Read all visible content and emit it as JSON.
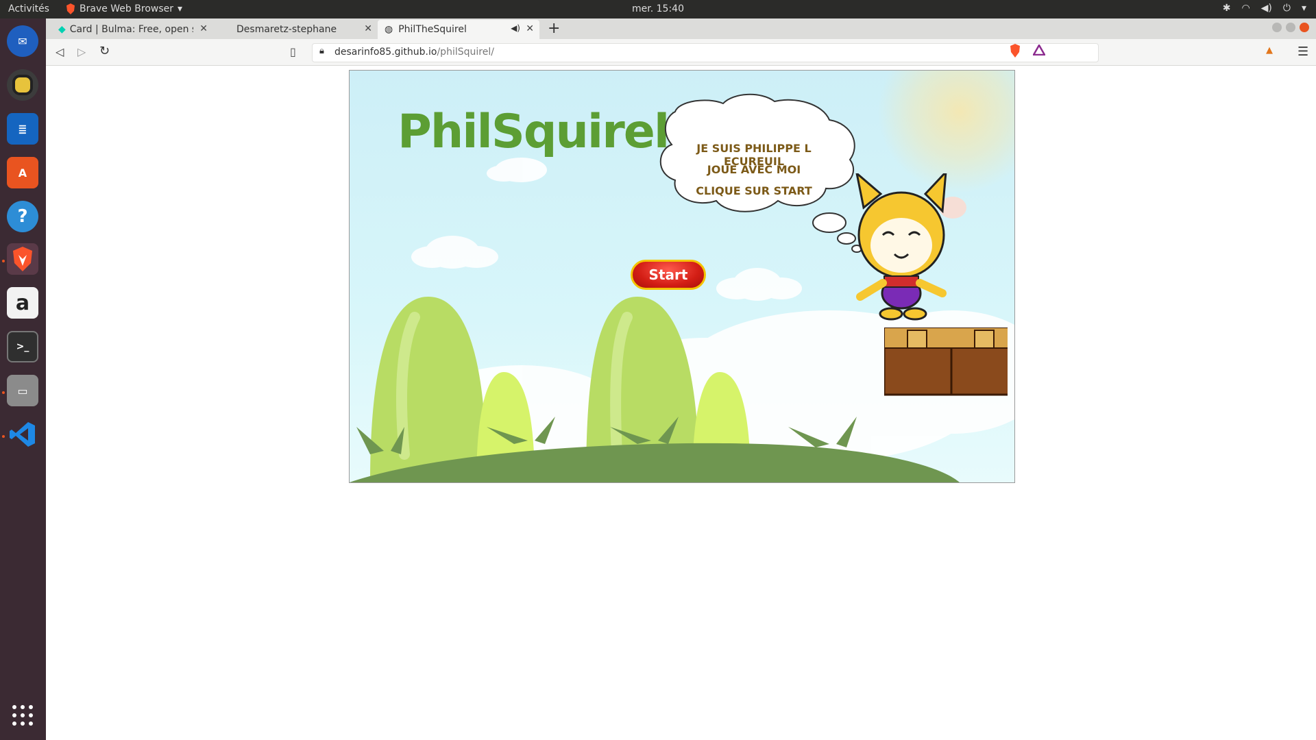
{
  "topbar": {
    "activities": "Activités",
    "app_name": "Brave Web Browser",
    "clock": "mer. 15:40"
  },
  "dock": {
    "items": [
      "thunderbird-icon",
      "rhythmbox-icon",
      "writer-icon",
      "software-icon",
      "help-icon",
      "brave-icon",
      "amazon-icon",
      "terminal-icon",
      "files-icon",
      "vscode-icon",
      "apps-grid-icon"
    ]
  },
  "tabs": [
    {
      "label": "Card | Bulma: Free, open so"
    },
    {
      "label": "Desmaretz-stephane"
    },
    {
      "label": "PhilTheSquirel"
    }
  ],
  "url": {
    "host": "desarinfo85.github.io",
    "path": "/philSquirel/"
  },
  "game": {
    "title": "PhilSquirell",
    "bubble_line1": "JE SUIS PHILIPPE L ECUREUIL",
    "bubble_line2": "JOUE AVEC MOI",
    "bubble_line3": "CLIQUE SUR START",
    "start_label": "Start"
  },
  "colors": {
    "title_green": "#5c9e34",
    "accent_orange": "#e95420",
    "button_red": "#d31e15"
  }
}
